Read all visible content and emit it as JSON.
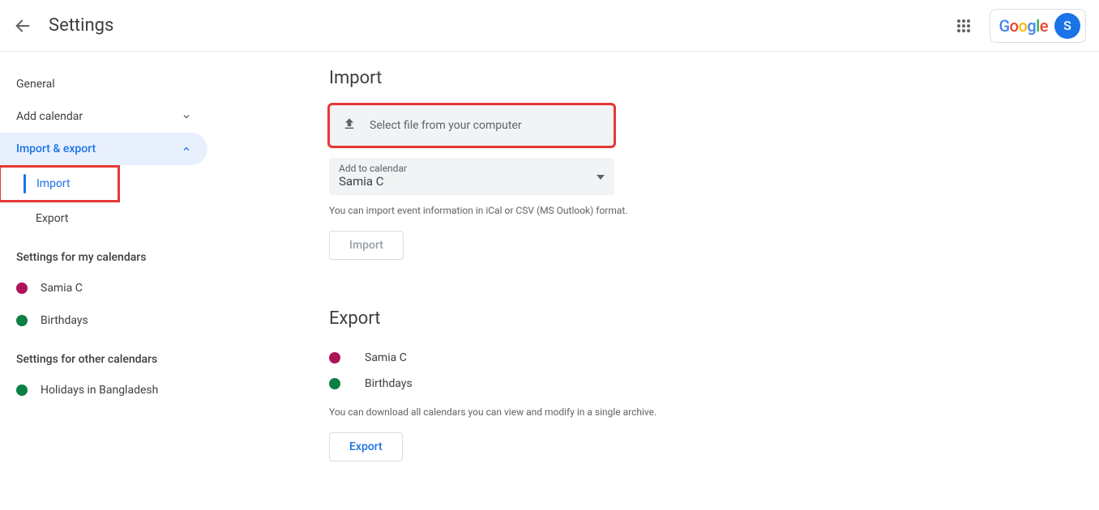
{
  "header": {
    "title": "Settings",
    "avatar_letter": "S"
  },
  "sidebar": {
    "general": "General",
    "add_calendar": "Add calendar",
    "import_export": "Import & export",
    "import": "Import",
    "export": "Export",
    "my_cal_header": "Settings for my calendars",
    "my_cals": [
      {
        "label": "Samia C",
        "color": "#ad1457"
      },
      {
        "label": "Birthdays",
        "color": "#0b8043"
      }
    ],
    "other_cal_header": "Settings for other calendars",
    "other_cals": [
      {
        "label": "Holidays in Bangladesh",
        "color": "#0b8043"
      }
    ]
  },
  "import": {
    "heading": "Import",
    "select_file": "Select file from your computer",
    "add_to_label": "Add to calendar",
    "add_to_value": "Samia C",
    "hint": "You can import event information in iCal or CSV (MS Outlook) format.",
    "button": "Import"
  },
  "export": {
    "heading": "Export",
    "items": [
      {
        "label": "Samia C",
        "color": "#ad1457"
      },
      {
        "label": "Birthdays",
        "color": "#0b8043"
      }
    ],
    "hint": "You can download all calendars you can view and modify in a single archive.",
    "button": "Export"
  }
}
